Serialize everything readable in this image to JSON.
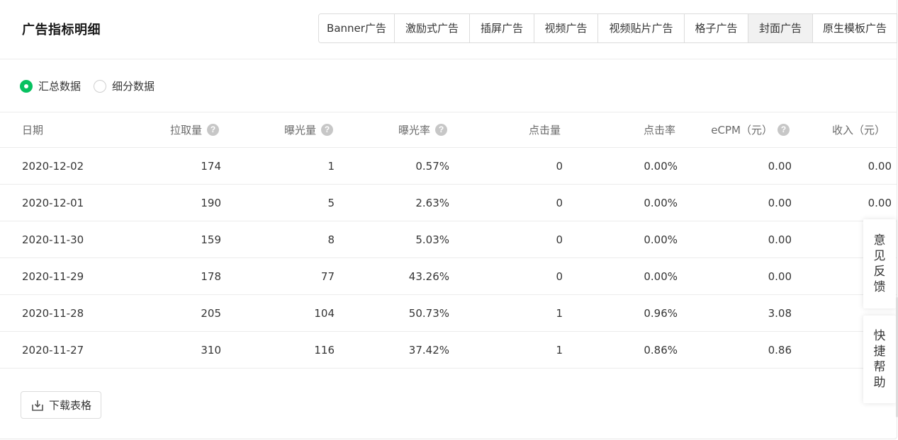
{
  "header": {
    "title": "广告指标明细",
    "tabs": [
      {
        "label": "Banner广告",
        "active": false
      },
      {
        "label": "激励式广告",
        "active": false
      },
      {
        "label": "插屏广告",
        "active": false
      },
      {
        "label": "视频广告",
        "active": false
      },
      {
        "label": "视频贴片广告",
        "active": false
      },
      {
        "label": "格子广告",
        "active": false
      },
      {
        "label": "封面广告",
        "active": true
      },
      {
        "label": "原生模板广告",
        "active": false
      }
    ]
  },
  "mode": {
    "options": [
      {
        "label": "汇总数据",
        "checked": true
      },
      {
        "label": "细分数据",
        "checked": false
      }
    ]
  },
  "table": {
    "headers": [
      {
        "label": "日期",
        "help": false
      },
      {
        "label": "拉取量",
        "help": true
      },
      {
        "label": "曝光量",
        "help": true
      },
      {
        "label": "曝光率",
        "help": true
      },
      {
        "label": "点击量",
        "help": false
      },
      {
        "label": "点击率",
        "help": false
      },
      {
        "label": "eCPM（元）",
        "help": true
      },
      {
        "label": "收入（元）",
        "help": false
      }
    ],
    "rows": [
      [
        "2020-12-02",
        "174",
        "1",
        "0.57%",
        "0",
        "0.00%",
        "0.00",
        "0.00"
      ],
      [
        "2020-12-01",
        "190",
        "5",
        "2.63%",
        "0",
        "0.00%",
        "0.00",
        "0.00"
      ],
      [
        "2020-11-30",
        "159",
        "8",
        "5.03%",
        "0",
        "0.00%",
        "0.00",
        ""
      ],
      [
        "2020-11-29",
        "178",
        "77",
        "43.26%",
        "0",
        "0.00%",
        "0.00",
        ""
      ],
      [
        "2020-11-28",
        "205",
        "104",
        "50.73%",
        "1",
        "0.96%",
        "3.08",
        ""
      ],
      [
        "2020-11-27",
        "310",
        "116",
        "37.42%",
        "1",
        "0.86%",
        "0.86",
        ""
      ]
    ]
  },
  "actions": {
    "download_label": "下载表格"
  },
  "floating": {
    "feedback_label": "意见反馈",
    "help_label": "快捷帮助"
  },
  "colors": {
    "accent": "#07c160",
    "help_icon": "#c7c7c7"
  },
  "icons": {
    "help": "question-circle-icon",
    "download": "download-icon"
  }
}
